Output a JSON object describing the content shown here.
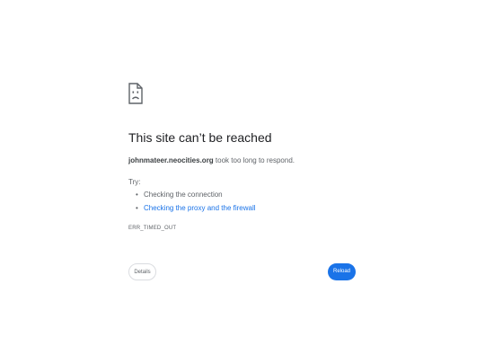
{
  "icon": "sad-page-icon",
  "headline": "This site can’t be reached",
  "summary": {
    "host": "johnmateer.neocities.org",
    "message": " took too long to respond."
  },
  "try_label": "Try:",
  "suggestions": [
    {
      "text": "Checking the connection",
      "is_link": false
    },
    {
      "text": "Checking the proxy and the firewall",
      "is_link": true
    }
  ],
  "error_code": "ERR_TIMED_OUT",
  "buttons": {
    "details_label": "Details",
    "reload_label": "Reload"
  },
  "colors": {
    "accent": "#1a73e8",
    "text_primary": "#202124",
    "text_secondary": "#5f6368"
  }
}
